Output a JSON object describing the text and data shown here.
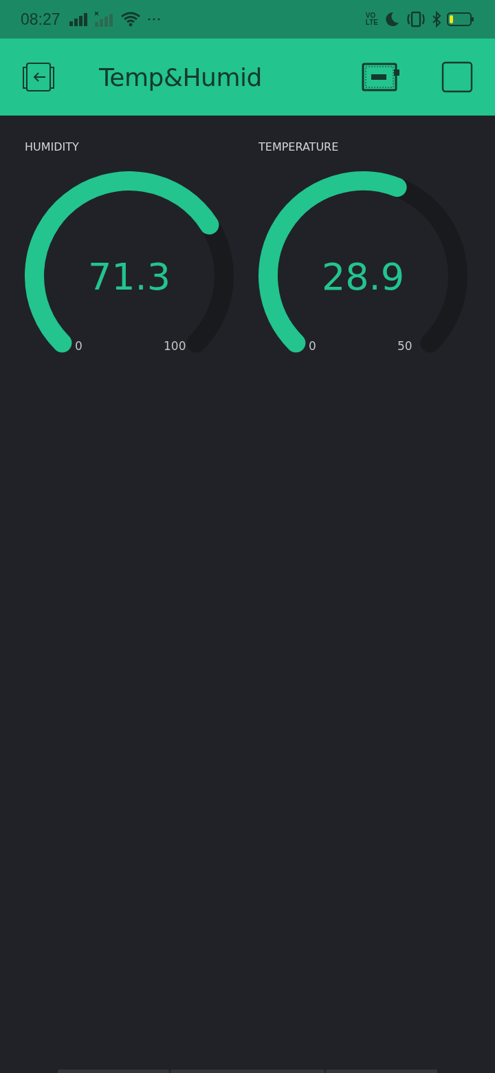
{
  "status_bar": {
    "time": "08:27",
    "network_label": [
      "VO",
      "LTE"
    ]
  },
  "header": {
    "title": "Temp&Humid"
  },
  "gauges": [
    {
      "label": "HUMIDITY",
      "value": "71.3",
      "min": "0",
      "max": "100"
    },
    {
      "label": "TEMPERATURE",
      "value": "28.9",
      "min": "0",
      "max": "50"
    }
  ]
}
